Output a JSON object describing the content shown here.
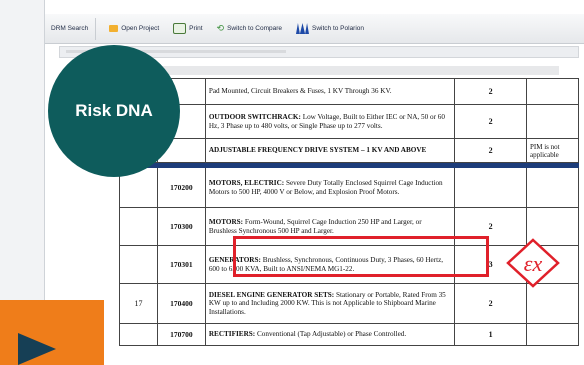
{
  "toolbar": {
    "drm_search": "DRM Search",
    "open_project": "Open Project",
    "print": "Print",
    "switch_compare": "Switch to Compare",
    "switch_polarion": "Switch to Polarion"
  },
  "badge": {
    "label": "Risk DNA"
  },
  "table": {
    "level_17": "17",
    "rows": [
      {
        "code": "",
        "title": "",
        "desc": "Pad Mounted, Circuit Breakers & Fuses, 1 KV Through 36 KV.",
        "num": "2",
        "note": ""
      },
      {
        "code": "",
        "title": "OUTDOOR SWITCHRACK:",
        "desc": " Low Voltage, Built to Either IEC or NA, 50 or 60 Hz, 3 Phase up to 480 volts, or Single Phase up to 277 volts.",
        "num": "2",
        "note": ""
      },
      {
        "code": "",
        "title": "ADJUSTABLE FREQUENCY DRIVE SYSTEM – 1 KV AND ABOVE",
        "desc": "",
        "num": "2",
        "note": "PIM is not applicable"
      },
      {
        "code": "170200",
        "title": "MOTORS, ELECTRIC:",
        "desc": " Severe Duty Totally Enclosed Squirrel Cage Induction Motors to 500 HP, 4000 V or Below, and Explosion Proof Motors.",
        "num": "",
        "note": ""
      },
      {
        "code": "170300",
        "title": "MOTORS:",
        "desc": " Form-Wound, Squirrel Cage Induction 250 HP and Larger, or Brushless Synchronous 500 HP and Larger.",
        "num": "2",
        "note": ""
      },
      {
        "code": "170301",
        "title": "GENERATORS:",
        "desc": " Brushless, Synchronous, Continuous Duty, 3 Phases, 60 Hertz, 600 to 6500 KVA, Built to ANSI/NEMA MG1-22.",
        "num": "3",
        "note": ""
      },
      {
        "code": "170400",
        "title": "DIESEL ENGINE GENERATOR SETS:",
        "desc": " Stationary or Portable, Rated From 35 KW up to and Including 2000 KW. This is not Applicable to Shipboard Marine Installations.",
        "num": "2",
        "note": ""
      },
      {
        "code": "170700",
        "title": "RECTIFIERS:",
        "desc": " Conventional (Tap Adjustable) or Phase Controlled.",
        "num": "1",
        "note": ""
      }
    ]
  },
  "colors": {
    "badge": "#0e5c5c",
    "highlight_box": "#e0202a",
    "orange_tab": "#ef7d1a",
    "separator": "#1d3d7a"
  },
  "icons": [
    "folder-icon",
    "print-icon",
    "compare-icon",
    "polarion-icon",
    "ex-hazard-icon",
    "play-icon"
  ]
}
